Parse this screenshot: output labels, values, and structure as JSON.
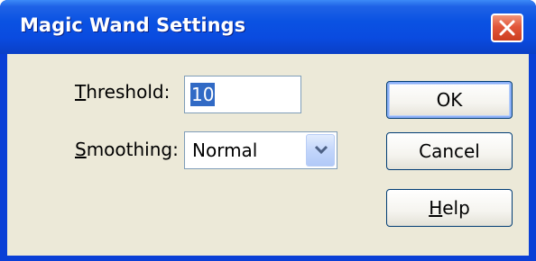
{
  "window": {
    "title": "Magic Wand Settings"
  },
  "form": {
    "threshold": {
      "label_accel": "T",
      "label_rest": "hreshold:",
      "value": "10"
    },
    "smoothing": {
      "label_accel": "S",
      "label_rest": "moothing:",
      "selected": "Normal"
    }
  },
  "buttons": {
    "ok": "OK",
    "cancel": "Cancel",
    "help_accel": "H",
    "help_rest": "elp"
  },
  "colors": {
    "titlebar": "#0a4be0",
    "client": "#ece9d8",
    "close_button": "#e2563a",
    "selection": "#316ac5"
  },
  "icons": {
    "close": "close-icon",
    "dropdown": "chevron-down-icon"
  }
}
